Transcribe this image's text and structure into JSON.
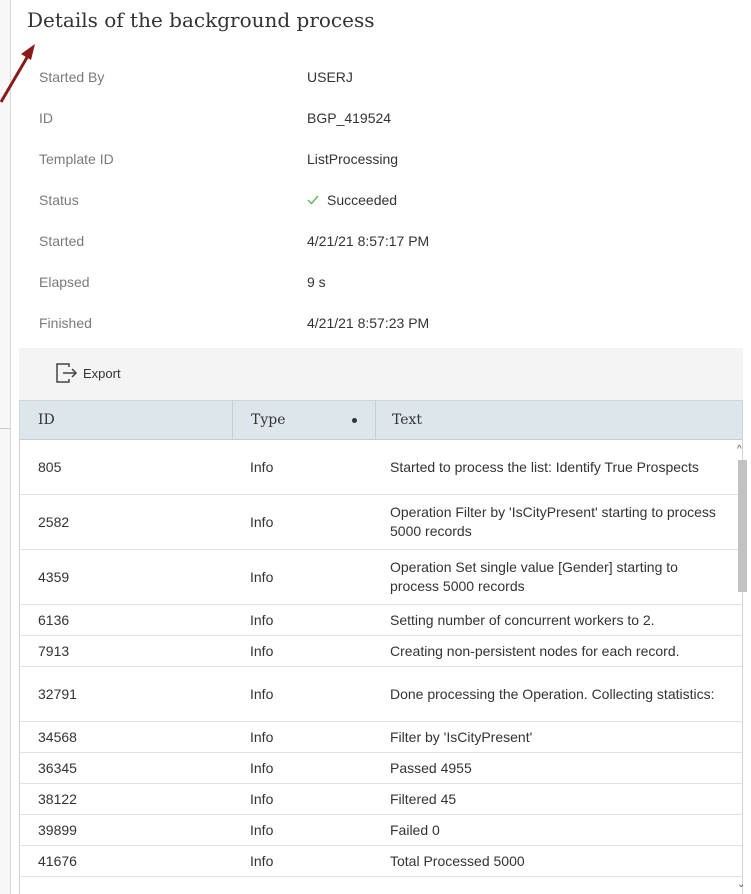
{
  "panel": {
    "title": "Details of the background process"
  },
  "details": [
    {
      "label": "Started By",
      "value": "USERJ"
    },
    {
      "label": "ID",
      "value": "BGP_419524"
    },
    {
      "label": "Template ID",
      "value": "ListProcessing"
    },
    {
      "label": "Status",
      "value": "Succeeded",
      "icon": "check-icon",
      "icon_color": "#5cb85c"
    },
    {
      "label": "Started",
      "value": "4/21/21 8:57:17 PM"
    },
    {
      "label": "Elapsed",
      "value": "9 s"
    },
    {
      "label": "Finished",
      "value": "4/21/21 8:57:23 PM"
    }
  ],
  "toolbar": {
    "export_label": "Export",
    "export_icon": "export-icon"
  },
  "grid": {
    "columns": [
      "ID",
      "Type",
      "Text"
    ],
    "rows": [
      {
        "id": "805",
        "type": "Info",
        "text": "Started to process the list: Identify True Prospects"
      },
      {
        "id": "2582",
        "type": "Info",
        "text": "Operation Filter by 'IsCityPresent' starting to process 5000 records"
      },
      {
        "id": "4359",
        "type": "Info",
        "text": "Operation Set single value [Gender] starting to process 5000 records"
      },
      {
        "id": "6136",
        "type": "Info",
        "text": "Setting number of concurrent workers to 2."
      },
      {
        "id": "7913",
        "type": "Info",
        "text": "Creating non-persistent nodes for each record."
      },
      {
        "id": "32791",
        "type": "Info",
        "text": "Done processing the Operation. Collecting statistics:"
      },
      {
        "id": "34568",
        "type": "Info",
        "text": "Filter by 'IsCityPresent'"
      },
      {
        "id": "36345",
        "type": "Info",
        "text": "Passed 4955"
      },
      {
        "id": "38122",
        "type": "Info",
        "text": "Filtered 45"
      },
      {
        "id": "39899",
        "type": "Info",
        "text": "Failed 0"
      },
      {
        "id": "41676",
        "type": "Info",
        "text": "Total Processed 5000"
      }
    ]
  },
  "colors": {
    "annotation_arrow": "#8b1a1a",
    "header_bg": "#dde6ea",
    "accent_check": "#5cb85c"
  }
}
